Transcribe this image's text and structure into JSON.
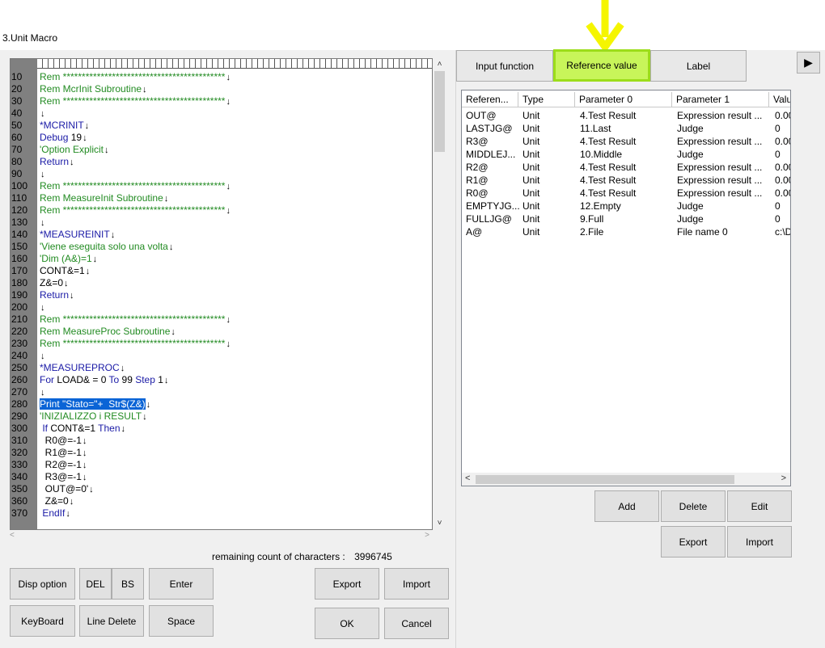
{
  "window": {
    "title": "3.Unit Macro"
  },
  "editor": {
    "lines": [
      {
        "n": "10",
        "segs": [
          {
            "t": "Rem *******************************************",
            "c": "rem"
          }
        ]
      },
      {
        "n": "20",
        "segs": [
          {
            "t": "Rem McrInit Subroutine",
            "c": "rem"
          }
        ]
      },
      {
        "n": "30",
        "segs": [
          {
            "t": "Rem *******************************************",
            "c": "rem"
          }
        ]
      },
      {
        "n": "40",
        "segs": []
      },
      {
        "n": "50",
        "segs": [
          {
            "t": "*MCRINIT",
            "c": "kw"
          }
        ]
      },
      {
        "n": "60",
        "segs": [
          {
            "t": "Debug ",
            "c": "kw"
          },
          {
            "t": "19",
            "c": "txt"
          }
        ]
      },
      {
        "n": "70",
        "segs": [
          {
            "t": "'Option Explicit",
            "c": "rem"
          }
        ]
      },
      {
        "n": "80",
        "segs": [
          {
            "t": "Return",
            "c": "kw"
          }
        ]
      },
      {
        "n": "90",
        "segs": []
      },
      {
        "n": "100",
        "segs": [
          {
            "t": "Rem *******************************************",
            "c": "rem"
          }
        ]
      },
      {
        "n": "110",
        "segs": [
          {
            "t": "Rem MeasureInit Subroutine",
            "c": "rem"
          }
        ]
      },
      {
        "n": "120",
        "segs": [
          {
            "t": "Rem *******************************************",
            "c": "rem"
          }
        ]
      },
      {
        "n": "130",
        "segs": []
      },
      {
        "n": "140",
        "segs": [
          {
            "t": "*MEASUREINIT",
            "c": "kw"
          }
        ]
      },
      {
        "n": "150",
        "segs": [
          {
            "t": "'Viene eseguita solo una volta",
            "c": "rem"
          }
        ]
      },
      {
        "n": "160",
        "segs": [
          {
            "t": "'Dim (A&)=1",
            "c": "rem"
          }
        ]
      },
      {
        "n": "170",
        "segs": [
          {
            "t": "CONT&=1",
            "c": "txt"
          }
        ]
      },
      {
        "n": "180",
        "segs": [
          {
            "t": "Z&=0",
            "c": "txt"
          }
        ]
      },
      {
        "n": "190",
        "segs": [
          {
            "t": "Return",
            "c": "kw"
          }
        ]
      },
      {
        "n": "200",
        "segs": []
      },
      {
        "n": "210",
        "segs": [
          {
            "t": "Rem *******************************************",
            "c": "rem"
          }
        ]
      },
      {
        "n": "220",
        "segs": [
          {
            "t": "Rem MeasureProc Subroutine",
            "c": "rem"
          }
        ]
      },
      {
        "n": "230",
        "segs": [
          {
            "t": "Rem *******************************************",
            "c": "rem"
          }
        ]
      },
      {
        "n": "240",
        "segs": []
      },
      {
        "n": "250",
        "segs": [
          {
            "t": "*MEASUREPROC",
            "c": "kw"
          }
        ]
      },
      {
        "n": "260",
        "segs": [
          {
            "t": "For ",
            "c": "kw"
          },
          {
            "t": "LOAD& = 0 ",
            "c": "txt"
          },
          {
            "t": "To ",
            "c": "kw"
          },
          {
            "t": "99 ",
            "c": "txt"
          },
          {
            "t": "Step ",
            "c": "kw"
          },
          {
            "t": "1",
            "c": "txt"
          }
        ]
      },
      {
        "n": "270",
        "segs": []
      },
      {
        "n": "280",
        "segs": [
          {
            "t": "Print \"Stato=\"+  Str$(Z&)",
            "c": "sel"
          }
        ]
      },
      {
        "n": "290",
        "segs": [
          {
            "t": "'INIZIALIZZO i RESULT",
            "c": "rem"
          }
        ]
      },
      {
        "n": "300",
        "segs": [
          {
            "t": " If ",
            "c": "kw"
          },
          {
            "t": "CONT&=1 ",
            "c": "txt"
          },
          {
            "t": "Then",
            "c": "kw"
          }
        ]
      },
      {
        "n": "310",
        "segs": [
          {
            "t": "  R0@=-1",
            "c": "txt"
          }
        ]
      },
      {
        "n": "320",
        "segs": [
          {
            "t": "  R1@=-1",
            "c": "txt"
          }
        ]
      },
      {
        "n": "330",
        "segs": [
          {
            "t": "  R2@=-1",
            "c": "txt"
          }
        ]
      },
      {
        "n": "340",
        "segs": [
          {
            "t": "  R3@=-1",
            "c": "txt"
          }
        ]
      },
      {
        "n": "350",
        "segs": [
          {
            "t": "  OUT@=0'",
            "c": "txt"
          }
        ]
      },
      {
        "n": "360",
        "segs": [
          {
            "t": "  Z&=0",
            "c": "txt"
          }
        ]
      },
      {
        "n": "370",
        "segs": [
          {
            "t": " EndIf",
            "c": "kw"
          }
        ]
      }
    ],
    "newline_glyph": "↓"
  },
  "status": {
    "remaining_label": "remaining count of characters :",
    "remaining_value": "3996745"
  },
  "left_buttons": {
    "disp_option": "Disp option",
    "del": "DEL",
    "bs": "BS",
    "enter": "Enter",
    "keyboard": "KeyBoard",
    "line_delete": "Line Delete",
    "space": "Space",
    "export": "Export",
    "import": "Import",
    "ok": "OK",
    "cancel": "Cancel"
  },
  "tabs": {
    "input_function": "Input function",
    "reference_value": "Reference value",
    "label": "Label",
    "next_arrow": "▶"
  },
  "table": {
    "columns": [
      "Referen...",
      "Type",
      "Parameter 0",
      "Parameter 1",
      "Valu"
    ],
    "rows": [
      [
        "OUT@",
        "Unit",
        "4.Test Result",
        "Expression result ...",
        "0.00"
      ],
      [
        "LASTJG@",
        "Unit",
        "11.Last",
        "Judge",
        "0"
      ],
      [
        "R3@",
        "Unit",
        "4.Test Result",
        "Expression result ...",
        "0.00"
      ],
      [
        "MIDDLEJ...",
        "Unit",
        "10.Middle",
        "Judge",
        "0"
      ],
      [
        "R2@",
        "Unit",
        "4.Test Result",
        "Expression result ...",
        "0.00"
      ],
      [
        "R1@",
        "Unit",
        "4.Test Result",
        "Expression result ...",
        "0.00"
      ],
      [
        "R0@",
        "Unit",
        "4.Test Result",
        "Expression result ...",
        "0.00"
      ],
      [
        "EMPTYJG...",
        "Unit",
        "12.Empty",
        "Judge",
        "0"
      ],
      [
        "FULLJG@",
        "Unit",
        "9.Full",
        "Judge",
        "0"
      ],
      [
        "A@",
        "Unit",
        "2.File",
        "File name 0",
        "c:\\D"
      ]
    ]
  },
  "right_buttons": {
    "add": "Add",
    "delete": "Delete",
    "edit": "Edit",
    "export": "Export",
    "import": "Import"
  },
  "colors": {
    "annotation": "#f5f500",
    "active_tab": "#c8f55a",
    "selection": "#0a64d6"
  }
}
